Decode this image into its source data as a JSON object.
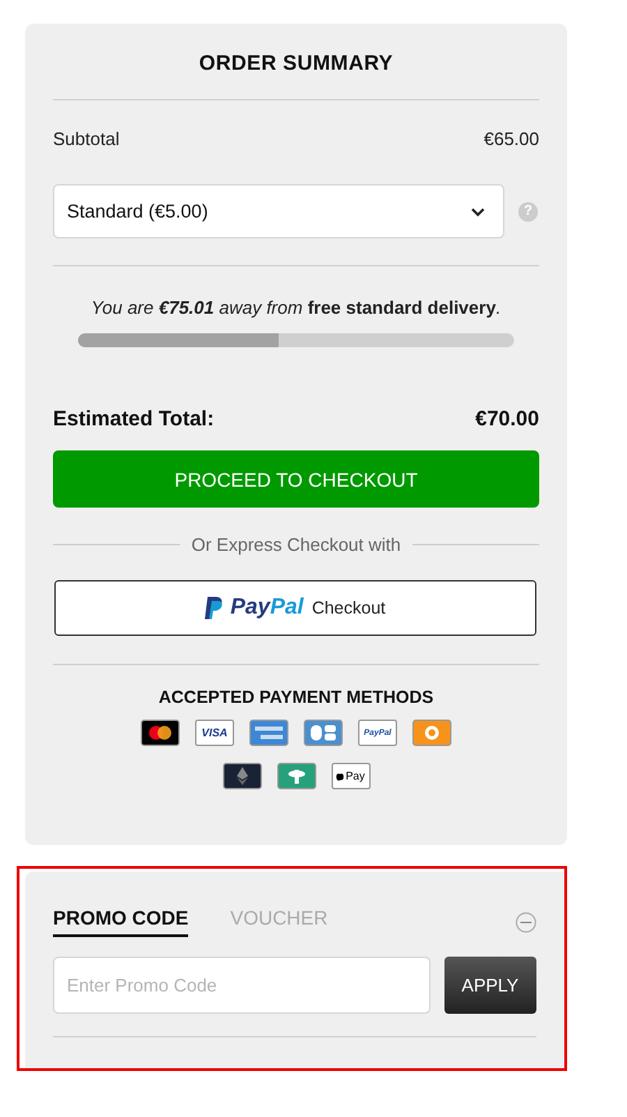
{
  "order_summary": {
    "title": "ORDER SUMMARY",
    "subtotal": {
      "label": "Subtotal",
      "value": "€65.00"
    },
    "shipping_select": {
      "value": "Standard (€5.00)"
    },
    "help": "?",
    "free_delivery": {
      "message": "You are **€75.01** away from **free standard delivery**.",
      "level": 0.46
    },
    "estimated_total": {
      "label": "Estimated Total:",
      "value": "€70.00"
    },
    "checkout_button": "PROCEED TO CHECKOUT",
    "express_label": "Or Express Checkout with",
    "paypal_button": {
      "brand": "PayPal",
      "label": "Checkout"
    },
    "payment_methods": {
      "title": "ACCEPTED PAYMENT METHODS",
      "rows": [
        [
          {
            "kind": "mastercard"
          },
          {
            "kind": "visa",
            "label": "VISA"
          },
          {
            "kind": "amex"
          },
          {
            "kind": "cb"
          },
          {
            "kind": "paypal",
            "label": "PayPal"
          },
          {
            "kind": "bitcoin"
          }
        ],
        [
          {
            "kind": "ethereum"
          },
          {
            "kind": "tether"
          },
          {
            "kind": "applepay",
            "label": "Pay"
          }
        ]
      ]
    }
  },
  "promo": {
    "tabs": [
      {
        "label": "PROMO CODE",
        "selected": true
      },
      {
        "label": "VOUCHER",
        "selected": false
      }
    ],
    "expanded": true,
    "input": {
      "placeholder": "Enter Promo Code"
    },
    "apply_button": "APPLY"
  }
}
